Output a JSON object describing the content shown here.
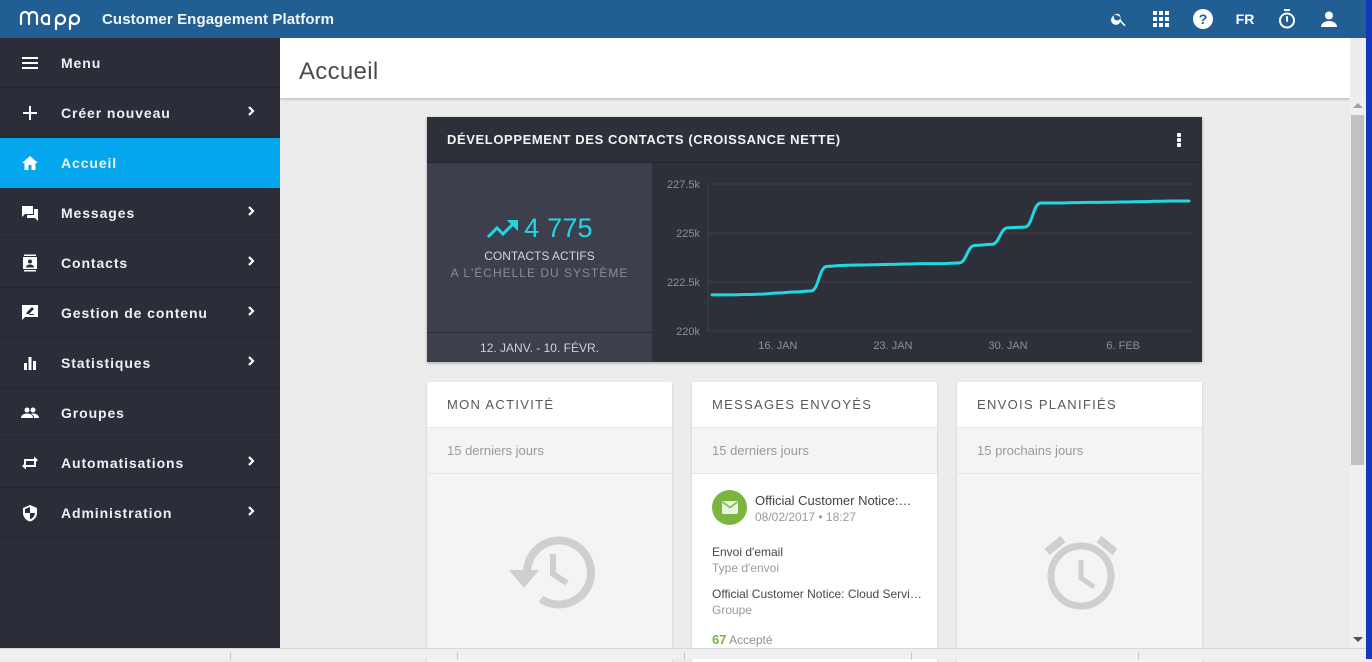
{
  "app": {
    "logo_text": "mapp",
    "title": "Customer Engagement Platform",
    "actions": [
      {
        "name": "search",
        "icon": "search-icon"
      },
      {
        "name": "apps",
        "icon": "apps-grid-icon"
      },
      {
        "name": "help",
        "icon": "help-icon"
      },
      {
        "name": "language",
        "label": "FR"
      },
      {
        "name": "timer",
        "icon": "stopwatch-icon"
      },
      {
        "name": "account",
        "icon": "user-icon"
      }
    ]
  },
  "sidebar": {
    "items": [
      {
        "label": "Menu",
        "icon": "hamburger-icon",
        "chevron": false,
        "active": false
      },
      {
        "label": "Créer nouveau",
        "icon": "plus-icon",
        "chevron": true,
        "active": false
      },
      {
        "label": "Accueil",
        "icon": "home-icon",
        "chevron": false,
        "active": true
      },
      {
        "label": "Messages",
        "icon": "chat-icon",
        "chevron": true,
        "active": false
      },
      {
        "label": "Contacts",
        "icon": "contact-card-icon",
        "chevron": true,
        "active": false
      },
      {
        "label": "Gestion de contenu",
        "icon": "edit-content-icon",
        "chevron": true,
        "active": false
      },
      {
        "label": "Statistiques",
        "icon": "bar-chart-icon",
        "chevron": true,
        "active": false
      },
      {
        "label": "Groupes",
        "icon": "people-icon",
        "chevron": false,
        "active": false
      },
      {
        "label": "Automatisations",
        "icon": "repeat-icon",
        "chevron": true,
        "active": false
      },
      {
        "label": "Administration",
        "icon": "shield-icon",
        "chevron": true,
        "active": false
      }
    ]
  },
  "page": {
    "title": "Accueil"
  },
  "contacts_widget": {
    "title": "DÉVELOPPEMENT DES CONTACTS (CROISSANCE NETTE)",
    "net_growth": "4 775",
    "label_primary": "CONTACTS ACTIFS",
    "label_secondary": "A L'ÉCHELLE DU SYSTÈME",
    "date_range": "12. JANV. - 10. FÉVR."
  },
  "chart_data": {
    "type": "line",
    "title": "DÉVELOPPEMENT DES CONTACTS (CROISSANCE NETTE)",
    "xlabel": "",
    "ylabel": "",
    "x": [
      "2017-01-12",
      "2017-01-13",
      "2017-01-14",
      "2017-01-15",
      "2017-01-16",
      "2017-01-17",
      "2017-01-18",
      "2017-01-19",
      "2017-01-20",
      "2017-01-21",
      "2017-01-22",
      "2017-01-23",
      "2017-01-24",
      "2017-01-25",
      "2017-01-26",
      "2017-01-27",
      "2017-01-28",
      "2017-01-29",
      "2017-01-30",
      "2017-01-31",
      "2017-02-01",
      "2017-02-02",
      "2017-02-03",
      "2017-02-04",
      "2017-02-05",
      "2017-02-06",
      "2017-02-07",
      "2017-02-08",
      "2017-02-09",
      "2017-02-10"
    ],
    "series": [
      {
        "name": "Contacts actifs",
        "color": "#21d7e2",
        "values": [
          221840,
          221840,
          221860,
          221880,
          221940,
          221990,
          222040,
          223300,
          223350,
          223370,
          223380,
          223400,
          223420,
          223440,
          223440,
          223470,
          224370,
          224420,
          225270,
          225300,
          226530,
          226530,
          226550,
          226560,
          226570,
          226580,
          226600,
          226620,
          226630,
          226630
        ]
      }
    ],
    "x_ticks": [
      {
        "label": "16. JAN",
        "index": 4
      },
      {
        "label": "23. JAN",
        "index": 11
      },
      {
        "label": "30. JAN",
        "index": 18
      },
      {
        "label": "6. FEB",
        "index": 25
      }
    ],
    "y_ticks": [
      {
        "label": "220k",
        "value": 220000
      },
      {
        "label": "222.5k",
        "value": 222500
      },
      {
        "label": "225k",
        "value": 225000
      },
      {
        "label": "227.5k",
        "value": 227500
      }
    ],
    "ylim": [
      220000,
      227500
    ],
    "grid": true,
    "legend": "none"
  },
  "cards": {
    "activity": {
      "title": "MON ACTIVITÉ",
      "subtitle": "15 derniers jours",
      "empty_icon": "history-icon"
    },
    "sent": {
      "title": "MESSAGES ENVOYÉS",
      "subtitle": "15 derniers jours",
      "message": {
        "title": "Official Customer Notice: Cloud Service",
        "date": "08/02/2017 • 18:27",
        "type_value": "Envoi d'email",
        "type_label": "Type d'envoi",
        "group_value": "Official Customer Notice: Cloud Service",
        "group_label": "Groupe",
        "accepted_count": "67",
        "accepted_label": "Accepté"
      }
    },
    "scheduled": {
      "title": "ENVOIS PLANIFIÉS",
      "subtitle": "15 prochains jours",
      "empty_icon": "alarm-clock-icon"
    }
  },
  "colors": {
    "topbar": "#215e94",
    "sidebar": "#2b2d38",
    "active": "#04a6ee",
    "accent": "#21d7e2",
    "success": "#7ab540"
  }
}
